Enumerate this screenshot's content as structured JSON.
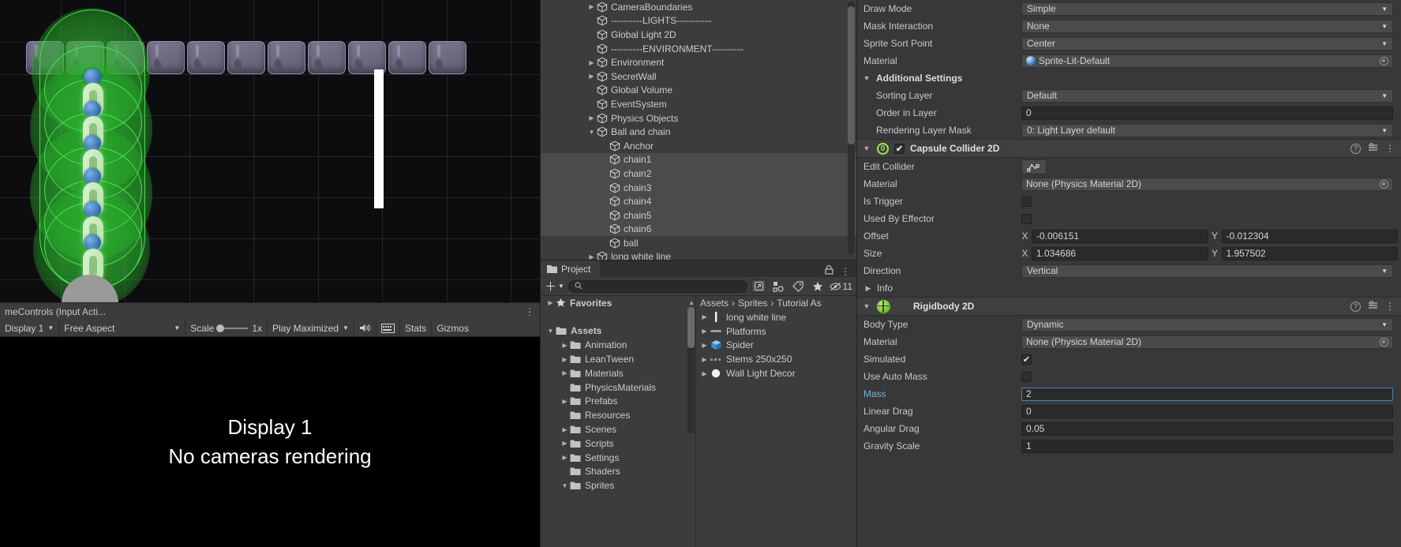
{
  "game_view": {
    "status_text": "meControls (Input Acti...",
    "toolbar": {
      "display": "Display 1",
      "aspect": "Free Aspect",
      "scale_label": "Scale",
      "scale_value": "1x",
      "play_maximized": "Play Maximized",
      "mute_icon": "speaker-icon",
      "stats": "Stats",
      "gizmos": "Gizmos"
    },
    "display_output": {
      "line1": "Display 1",
      "line2": "No cameras rendering"
    }
  },
  "hierarchy": {
    "items": [
      {
        "label": "CameraBoundaries",
        "indent": 1,
        "twisty": "right",
        "selected": false
      },
      {
        "label": "----------LIGHTS-----------",
        "indent": 1,
        "twisty": "",
        "selected": false
      },
      {
        "label": "Global Light 2D",
        "indent": 1,
        "twisty": "",
        "selected": false
      },
      {
        "label": "----------ENVIRONMENT----------",
        "indent": 1,
        "twisty": "",
        "selected": false
      },
      {
        "label": "Environment",
        "indent": 1,
        "twisty": "right",
        "selected": false
      },
      {
        "label": "SecretWall",
        "indent": 1,
        "twisty": "right",
        "selected": false
      },
      {
        "label": "Global Volume",
        "indent": 1,
        "twisty": "",
        "selected": false
      },
      {
        "label": "EventSystem",
        "indent": 1,
        "twisty": "",
        "selected": false
      },
      {
        "label": "Physics Objects",
        "indent": 1,
        "twisty": "right",
        "selected": false
      },
      {
        "label": "Ball and chain",
        "indent": 1,
        "twisty": "down",
        "selected": false
      },
      {
        "label": "Anchor",
        "indent": 2,
        "twisty": "",
        "selected": false
      },
      {
        "label": "chain1",
        "indent": 2,
        "twisty": "",
        "selected": true
      },
      {
        "label": "chain2",
        "indent": 2,
        "twisty": "",
        "selected": true
      },
      {
        "label": "chain3",
        "indent": 2,
        "twisty": "",
        "selected": true
      },
      {
        "label": "chain4",
        "indent": 2,
        "twisty": "",
        "selected": true
      },
      {
        "label": "chain5",
        "indent": 2,
        "twisty": "",
        "selected": true
      },
      {
        "label": "chain6",
        "indent": 2,
        "twisty": "",
        "selected": true
      },
      {
        "label": "ball",
        "indent": 2,
        "twisty": "",
        "selected": false
      },
      {
        "label": "long white line",
        "indent": 1,
        "twisty": "right",
        "selected": false
      }
    ]
  },
  "project": {
    "tab_label": "Project",
    "search_placeholder": "",
    "search_value": "",
    "hidden_count": "11",
    "tree": [
      {
        "label": "Favorites",
        "indent": 0,
        "twisty": "right",
        "icon": "star",
        "bold": true
      },
      {
        "label": "",
        "indent": 0,
        "twisty": "",
        "icon": "none",
        "bold": false
      },
      {
        "label": "Assets",
        "indent": 0,
        "twisty": "down",
        "icon": "folder",
        "bold": true
      },
      {
        "label": "Animation",
        "indent": 1,
        "twisty": "right",
        "icon": "folder",
        "bold": false
      },
      {
        "label": "LeanTween",
        "indent": 1,
        "twisty": "right",
        "icon": "folder",
        "bold": false
      },
      {
        "label": "Materials",
        "indent": 1,
        "twisty": "right",
        "icon": "folder",
        "bold": false
      },
      {
        "label": "PhysicsMaterials",
        "indent": 1,
        "twisty": "",
        "icon": "folder",
        "bold": false
      },
      {
        "label": "Prefabs",
        "indent": 1,
        "twisty": "right",
        "icon": "folder",
        "bold": false
      },
      {
        "label": "Resources",
        "indent": 1,
        "twisty": "",
        "icon": "folder",
        "bold": false
      },
      {
        "label": "Scenes",
        "indent": 1,
        "twisty": "right",
        "icon": "folder",
        "bold": false
      },
      {
        "label": "Scripts",
        "indent": 1,
        "twisty": "right",
        "icon": "folder",
        "bold": false
      },
      {
        "label": "Settings",
        "indent": 1,
        "twisty": "right",
        "icon": "folder",
        "bold": false
      },
      {
        "label": "Shaders",
        "indent": 1,
        "twisty": "",
        "icon": "folder",
        "bold": false
      },
      {
        "label": "Sprites",
        "indent": 1,
        "twisty": "down",
        "icon": "folder",
        "bold": false
      }
    ],
    "breadcrumb": [
      "Assets",
      "Sprites",
      "Tutorial As"
    ],
    "assets": [
      {
        "label": "long white line",
        "icon": "white-line"
      },
      {
        "label": "Platforms",
        "icon": "platform"
      },
      {
        "label": "Spider",
        "icon": "prefab-cube"
      },
      {
        "label": "Stems 250x250",
        "icon": "stems"
      },
      {
        "label": "Wall Light Decor",
        "icon": "white-dot"
      }
    ]
  },
  "inspector": {
    "sprite_renderer_rows": [
      {
        "label": "Draw Mode",
        "type": "dropdown",
        "value": "Simple",
        "indent": 0
      },
      {
        "label": "Mask Interaction",
        "type": "dropdown",
        "value": "None",
        "indent": 0
      },
      {
        "label": "Sprite Sort Point",
        "type": "dropdown",
        "value": "Center",
        "indent": 0
      },
      {
        "label": "Material",
        "type": "object",
        "value": "Sprite-Lit-Default",
        "indent": 0
      }
    ],
    "additional_settings": {
      "title": "Additional Settings",
      "rows": [
        {
          "label": "Sorting Layer",
          "type": "dropdown",
          "value": "Default",
          "indent": 1
        },
        {
          "label": "Order in Layer",
          "type": "text",
          "value": "0",
          "indent": 1
        },
        {
          "label": "Rendering Layer Mask",
          "type": "dropdown",
          "value": "0: Light Layer default",
          "indent": 1
        }
      ]
    },
    "capsule_collider": {
      "title": "Capsule Collider 2D",
      "badge": "0",
      "enabled": true,
      "edit_collider_label": "Edit Collider",
      "rows": [
        {
          "label": "Material",
          "type": "object",
          "value": "None (Physics Material 2D)"
        },
        {
          "label": "Is Trigger",
          "type": "checkbox",
          "value": false
        },
        {
          "label": "Used By Effector",
          "type": "checkbox",
          "value": false
        }
      ],
      "offset": {
        "label": "Offset",
        "x_label": "X",
        "x": "-0.006151",
        "y_label": "Y",
        "y": "-0.012304"
      },
      "size": {
        "label": "Size",
        "x_label": "X",
        "x": "1.034686",
        "y_label": "Y",
        "y": "1.957502"
      },
      "direction": {
        "label": "Direction",
        "value": "Vertical"
      },
      "info_label": "Info"
    },
    "rigidbody": {
      "title": "Rigidbody 2D",
      "rows": [
        {
          "label": "Body Type",
          "type": "dropdown",
          "value": "Dynamic",
          "highlight": false
        },
        {
          "label": "Material",
          "type": "object",
          "value": "None (Physics Material 2D)",
          "highlight": false
        },
        {
          "label": "Simulated",
          "type": "checkbox",
          "value": true,
          "highlight": false
        },
        {
          "label": "Use Auto Mass",
          "type": "checkbox",
          "value": false,
          "highlight": false
        },
        {
          "label": "Mass",
          "type": "text-focused",
          "value": "2",
          "highlight": true
        },
        {
          "label": "Linear Drag",
          "type": "text",
          "value": "0",
          "highlight": false
        },
        {
          "label": "Angular Drag",
          "type": "text",
          "value": "0.05",
          "highlight": false
        },
        {
          "label": "Gravity Scale",
          "type": "text",
          "value": "1",
          "highlight": false
        }
      ]
    }
  },
  "annotation": {
    "arrow_color": "#ee1111"
  },
  "colors": {
    "accent_focus": "#4d7ec8",
    "gizmo_green": "#49e051",
    "panel_bg": "#383838",
    "row_bg": "#3c3c3c"
  }
}
